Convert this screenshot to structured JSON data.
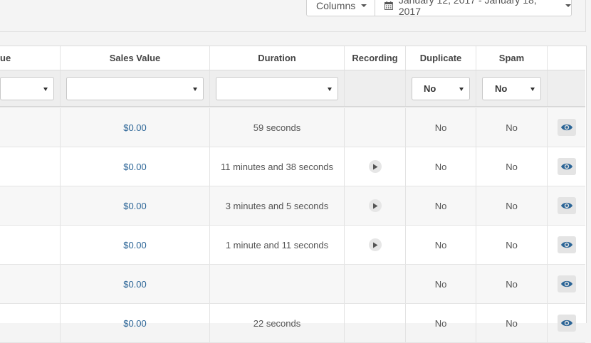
{
  "toolbar": {
    "columns_label": "Columns",
    "date_range": "January 12, 2017 - January 18, 2017"
  },
  "table": {
    "headers": [
      "ue",
      "Sales Value",
      "Duration",
      "Recording",
      "Duplicate",
      "Spam",
      ""
    ],
    "filters": {
      "duplicate": "No",
      "spam": "No"
    },
    "rows": [
      {
        "sales_value": "$0.00",
        "duration": "59 seconds",
        "recording": false,
        "duplicate": "No",
        "spam": "No"
      },
      {
        "sales_value": "$0.00",
        "duration": "11 minutes and 38 seconds",
        "recording": true,
        "duplicate": "No",
        "spam": "No"
      },
      {
        "sales_value": "$0.00",
        "duration": "3 minutes and 5 seconds",
        "recording": true,
        "duplicate": "No",
        "spam": "No"
      },
      {
        "sales_value": "$0.00",
        "duration": "1 minute and 11 seconds",
        "recording": true,
        "duplicate": "No",
        "spam": "No"
      },
      {
        "sales_value": "$0.00",
        "duration": "",
        "recording": false,
        "duplicate": "No",
        "spam": "No"
      },
      {
        "sales_value": "$0.00",
        "duration": "22 seconds",
        "recording": false,
        "duplicate": "No",
        "spam": "No"
      }
    ]
  },
  "colors": {
    "link": "#2a6496",
    "eye": "#2a6496"
  },
  "icons": {
    "calendar": "calendar-icon",
    "play": "play-icon",
    "view": "eye-icon"
  }
}
